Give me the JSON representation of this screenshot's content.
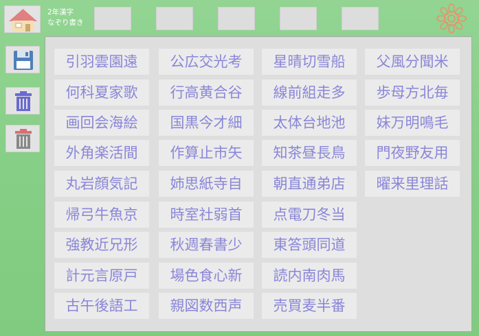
{
  "app": {
    "title_line1": "2年漢字",
    "title_line2": "なぞり書き"
  },
  "toolbar": {
    "home_icon": "house-icon",
    "settings_icon": "gear-flower-icon",
    "slot_count": 5
  },
  "sidebar": {
    "save_icon": "floppy-disk-icon",
    "delete_icon": "trash-icon",
    "delete_all_icon": "trash-all-icon"
  },
  "colors": {
    "background": "#86cf86",
    "panel": "#dedede",
    "cell": "#ebebeb",
    "kanji_text": "#8a86d8",
    "home_roof": "#e08080",
    "home_wall": "#f5deb3",
    "save_icon": "#4f7fb8",
    "trash_blue": "#6a6ad0",
    "trash_gray": "#888888"
  },
  "kanji_groups": [
    [
      "引羽雲園遠",
      "何科夏家歌",
      "画回会海絵",
      "外角楽活間",
      "丸岩顔気記",
      "帰弓牛魚京",
      "強教近兄形",
      "計元言原戸",
      "古午後語工"
    ],
    [
      "公広交光考",
      "行高黄合谷",
      "国黒今才細",
      "作算止市矢",
      "姉思紙寺自",
      "時室社弱首",
      "秋週春書少",
      "場色食心新",
      "親図数西声"
    ],
    [
      "星晴切雪船",
      "線前組走多",
      "太体台地池",
      "知茶昼長鳥",
      "朝直通弟店",
      "点電刀冬当",
      "東答頭同道",
      "読内南肉馬",
      "売買麦半番"
    ],
    [
      "父風分聞米",
      "歩母方北毎",
      "妹万明鳴毛",
      "門夜野友用",
      "曜来里理話"
    ]
  ]
}
